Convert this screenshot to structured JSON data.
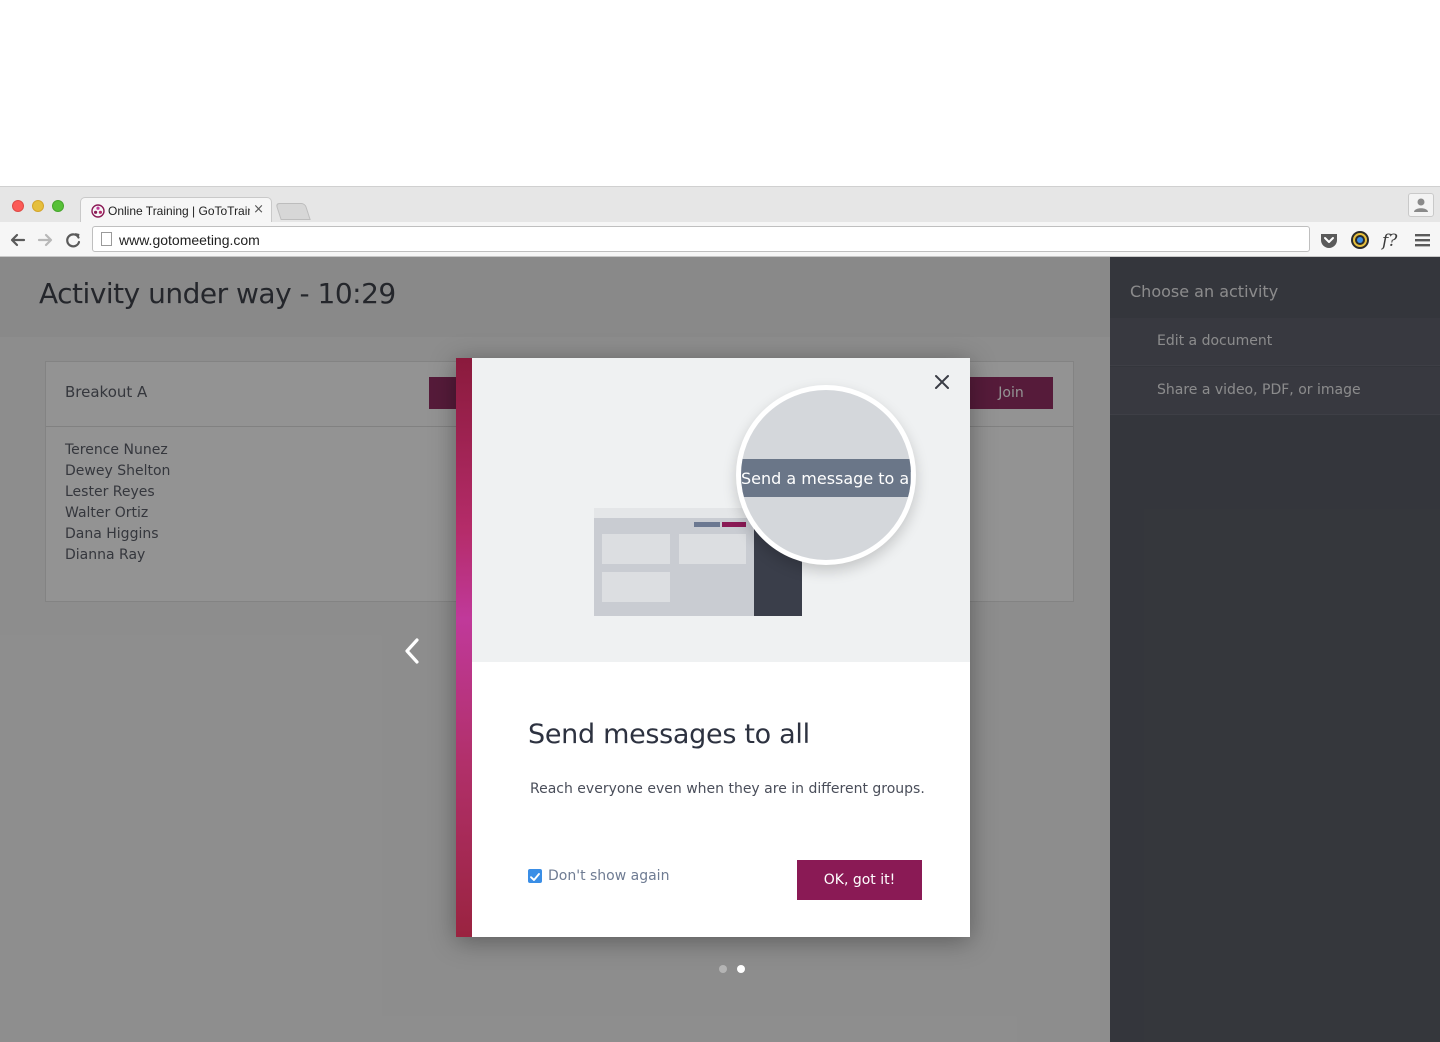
{
  "browser": {
    "tab_title": "Online Training | GoToTraining",
    "tab_close": "×",
    "url": "www.gotomeeting.com"
  },
  "page": {
    "activity_title": "Activity under way - 10:29",
    "breakout": {
      "name": "Breakout A",
      "join_label": "Join",
      "members": [
        "Terence Nunez",
        "Dewey Shelton",
        "Lester Reyes",
        "Walter Ortiz",
        "Dana Higgins",
        "Dianna Ray"
      ]
    },
    "sidebar": {
      "title": "Choose an activity",
      "items": [
        {
          "label": "Edit a document"
        },
        {
          "label": "Share a video, PDF, or image"
        }
      ]
    }
  },
  "modal": {
    "magnifier_label": "Send a message to all",
    "title": "Send messages to all",
    "body": "Reach everyone even when they are in different groups.",
    "dont_show_label": "Don't show again",
    "dont_show_checked": true,
    "ok_label": "OK, got it!",
    "pager": {
      "count": 2,
      "active_index": 1
    }
  },
  "colors": {
    "brand": "#8a1a55",
    "sidebar": "#4a4d58",
    "checkbox": "#3a8ee6"
  }
}
